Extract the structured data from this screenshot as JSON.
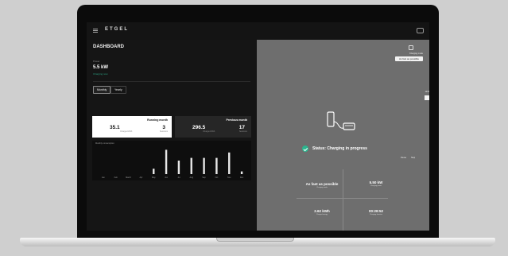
{
  "app": {
    "brand": "ETGEL"
  },
  "dashboard": {
    "title": "DASHBOARD",
    "current_label": "Power",
    "current_value": "5.5 kW",
    "current_status": "Charging now",
    "buttons": [
      "Monthly",
      "Yearly"
    ]
  },
  "cards": [
    {
      "title": "Running month",
      "value1": "35.1",
      "unit1": "Charged kWh",
      "value2": "3",
      "unit2": "Sessions"
    },
    {
      "title": "Previous month",
      "value1": "296.5",
      "unit1": "Charged kWh",
      "value2": "17",
      "unit2": "Sessions"
    }
  ],
  "chart_label": "Monthly consumption",
  "chart_data": {
    "type": "bar",
    "categories": [
      "Jan",
      "Feb",
      "March",
      "Apr",
      "May",
      "Jun",
      "Jul",
      "Aug",
      "Sep",
      "Oct",
      "Nov",
      "Dec"
    ],
    "values": [
      0,
      0,
      0,
      0,
      2,
      9,
      5,
      6,
      6,
      6,
      8,
      1
    ],
    "ylim": [
      0,
      10
    ]
  },
  "right_panel": {
    "mode_label": "Charging mode",
    "mode_button": "As fast as possible",
    "edge_label": "Limit",
    "status": "Status: Charging in progress",
    "side_a": "Pause",
    "side_b": "Stop",
    "stats": [
      {
        "value": "As fast as possible",
        "label": "Charging mode"
      },
      {
        "value": "5.50 kW",
        "label": "Charging power"
      },
      {
        "value": "2.62 kWh",
        "label": "Charged energy"
      },
      {
        "value": "00:28:52",
        "label": "Charging duration"
      }
    ]
  },
  "colors": {
    "accent": "#2bb58e",
    "panel": "#6e6e6e"
  },
  "icons": [
    "menu-icon",
    "car-icon",
    "lock-icon",
    "charger-icon",
    "check-icon"
  ]
}
